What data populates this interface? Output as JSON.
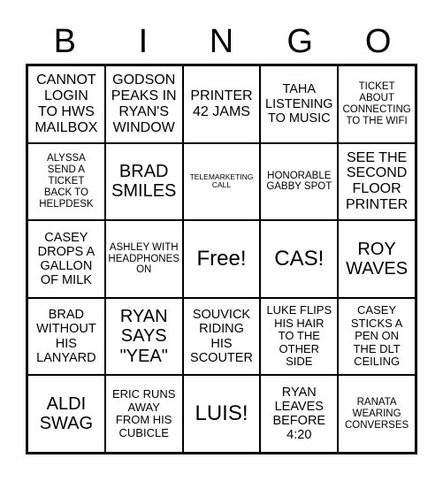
{
  "header": {
    "letters": [
      "B",
      "I",
      "N",
      "G",
      "O"
    ]
  },
  "card": {
    "rows": [
      [
        {
          "text": "CANNOT\nLOGIN\nTO HWS\nMAILBOX",
          "size": "fs-m"
        },
        {
          "text": "GODSON\nPEAKS IN\nRYAN'S\nWINDOW",
          "size": "fs-m"
        },
        {
          "text": "PRINTER\n42 JAMS",
          "size": "fs-m"
        },
        {
          "text": "TAHA\nLISTENING\nTO MUSIC",
          "size": "fs-ms"
        },
        {
          "text": "TICKET\nABOUT\nCONNECTING\nTO THE WIFI",
          "size": "fs-xs"
        }
      ],
      [
        {
          "text": "ALYSSA\nSEND A\nTICKET\nBACK TO\nHELPDESK",
          "size": "fs-xs"
        },
        {
          "text": "BRAD\nSMILES",
          "size": "fs-l"
        },
        {
          "text": "TELEMARKETING\nCALL",
          "size": "fs-xxs"
        },
        {
          "text": "HONORABLE\nGABBY SPOT",
          "size": "fs-xs"
        },
        {
          "text": "SEE THE\nSECOND\nFLOOR\nPRINTER",
          "size": "fs-m"
        }
      ],
      [
        {
          "text": "CASEY\nDROPS A\nGALLON\nOF MILK",
          "size": "fs-ms"
        },
        {
          "text": "ASHLEY WITH\nHEADPHONES\nON",
          "size": "fs-xs"
        },
        {
          "text": "Free!",
          "size": "fs-xl"
        },
        {
          "text": "CAS!",
          "size": "fs-xl"
        },
        {
          "text": "ROY\nWAVES",
          "size": "fs-l"
        }
      ],
      [
        {
          "text": "BRAD\nWITHOUT\nHIS\nLANYARD",
          "size": "fs-ms"
        },
        {
          "text": "RYAN\nSAYS\n\"YEA\"",
          "size": "fs-l"
        },
        {
          "text": "SOUVICK\nRIDING\nHIS\nSCOUTER",
          "size": "fs-ms"
        },
        {
          "text": "LUKE FLIPS\nHIS HAIR\nTO THE\nOTHER\nSIDE",
          "size": "fs-s"
        },
        {
          "text": "CASEY\nSTICKS A\nPEN ON\nTHE DLT\nCEILING",
          "size": "fs-s"
        }
      ],
      [
        {
          "text": "ALDI\nSWAG",
          "size": "fs-l"
        },
        {
          "text": "ERIC RUNS\nAWAY\nFROM HIS\nCUBICLE",
          "size": "fs-s"
        },
        {
          "text": "LUIS!",
          "size": "fs-xl"
        },
        {
          "text": "RYAN\nLEAVES\nBEFORE\n4:20",
          "size": "fs-ms"
        },
        {
          "text": "RANATA\nWEARING\nCONVERSES",
          "size": "fs-xs"
        }
      ]
    ]
  },
  "colors": {
    "background": "#ffffff",
    "text": "#000000",
    "border": "#000000"
  }
}
